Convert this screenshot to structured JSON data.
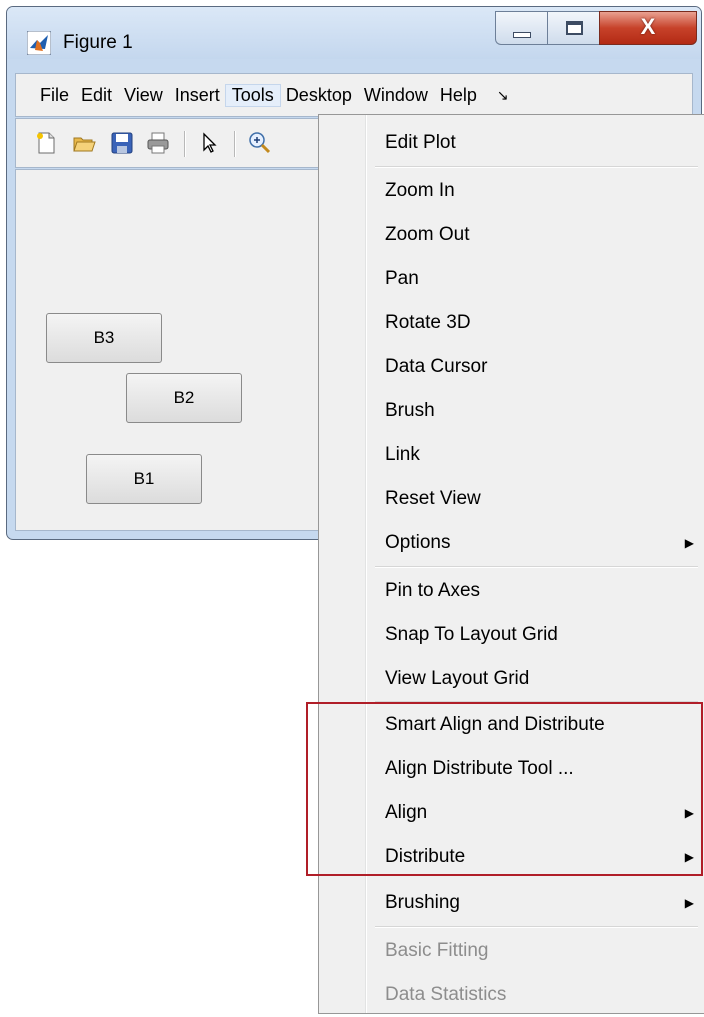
{
  "window": {
    "title": "Figure 1",
    "close_symbol": "X",
    "icons": [
      "matlab-icon",
      "minimize-icon",
      "maximize-icon",
      "close-icon"
    ]
  },
  "menubar": {
    "items": [
      "File",
      "Edit",
      "View",
      "Insert",
      "Tools",
      "Desktop",
      "Window",
      "Help"
    ],
    "overflow_symbol": "↘"
  },
  "toolbar": {
    "icons": [
      "new-figure-icon",
      "open-file-icon",
      "save-icon",
      "print-icon",
      "pointer-icon",
      "zoom-in-icon"
    ]
  },
  "canvas": {
    "buttons": [
      "B3",
      "B2",
      "B1"
    ]
  },
  "tools_menu": {
    "items": [
      {
        "label": "Edit Plot",
        "submenu": false,
        "enabled": true
      },
      {
        "label": "Zoom In",
        "submenu": false,
        "enabled": true
      },
      {
        "label": "Zoom Out",
        "submenu": false,
        "enabled": true
      },
      {
        "label": "Pan",
        "submenu": false,
        "enabled": true
      },
      {
        "label": "Rotate 3D",
        "submenu": false,
        "enabled": true
      },
      {
        "label": "Data Cursor",
        "submenu": false,
        "enabled": true
      },
      {
        "label": "Brush",
        "submenu": false,
        "enabled": true
      },
      {
        "label": "Link",
        "submenu": false,
        "enabled": true
      },
      {
        "label": "Reset View",
        "submenu": false,
        "enabled": true
      },
      {
        "label": "Options",
        "submenu": true,
        "enabled": true
      },
      {
        "label": "Pin to Axes",
        "submenu": false,
        "enabled": true
      },
      {
        "label": "Snap To Layout Grid",
        "submenu": false,
        "enabled": true
      },
      {
        "label": "View Layout Grid",
        "submenu": false,
        "enabled": true
      },
      {
        "label": "Smart Align and Distribute",
        "submenu": false,
        "enabled": true
      },
      {
        "label": "Align Distribute Tool ...",
        "submenu": false,
        "enabled": true
      },
      {
        "label": "Align",
        "submenu": true,
        "enabled": true
      },
      {
        "label": "Distribute",
        "submenu": true,
        "enabled": true
      },
      {
        "label": "Brushing",
        "submenu": true,
        "enabled": true
      },
      {
        "label": "Basic Fitting",
        "submenu": false,
        "enabled": false
      },
      {
        "label": "Data Statistics",
        "submenu": false,
        "enabled": false
      }
    ],
    "submenu_arrow": "▶"
  },
  "colors": {
    "highlight_border": "#b01e28",
    "menu_bg": "#f0f0f0",
    "disabled_text": "#8d8d8d",
    "window_frame": "#c6d9ef"
  }
}
